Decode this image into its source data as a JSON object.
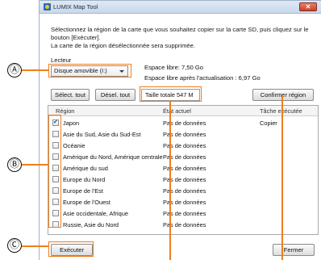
{
  "window": {
    "title": "LUMIX Map Tool",
    "close_label": "✕"
  },
  "description": {
    "line1": "Sélectionnez la région de la carte que vous souhaitez copier sur la carte SD, puis cliquez sur le",
    "line2": "bouton [Exécuter].",
    "line3": "La carte de la région désélectionnée sera supprimée."
  },
  "drive": {
    "label": "Lecteur",
    "selected": "Disque amovible (I:)"
  },
  "space": {
    "free": "Espace libre:  7,50 Go",
    "after": "Espace libre après l'actualisation :  6,97 Go"
  },
  "buttons": {
    "select_all": "Sélect. tout",
    "deselect_all": "Désel. tout",
    "confirm": "Confirmer région",
    "execute": "Exécuter",
    "close": "Fermer"
  },
  "total_size": "Taille totale  547 M",
  "list": {
    "headers": {
      "region": "Région",
      "state": "État actuel",
      "task": "Tâche exécutée"
    },
    "rows": [
      {
        "name": "Japon",
        "state": "Pas de données",
        "task": "Copier",
        "checked": true
      },
      {
        "name": "Asie du Sud, Asie du Sud-Est",
        "state": "Pas de données",
        "task": "",
        "checked": false
      },
      {
        "name": "Océanie",
        "state": "Pas de données",
        "task": "",
        "checked": false
      },
      {
        "name": "Amérique du Nord, Amérique centrale",
        "state": "Pas de données",
        "task": "",
        "checked": false
      },
      {
        "name": "Amérique du sud",
        "state": "Pas de données",
        "task": "",
        "checked": false
      },
      {
        "name": "Europe du Nord",
        "state": "Pas de données",
        "task": "",
        "checked": false
      },
      {
        "name": "Europe de l'Est",
        "state": "Pas de données",
        "task": "",
        "checked": false
      },
      {
        "name": "Europe de l'Ouest",
        "state": "Pas de données",
        "task": "",
        "checked": false
      },
      {
        "name": "Asie occidentale, Afrique",
        "state": "Pas de données",
        "task": "",
        "checked": false
      },
      {
        "name": "Russie, Asie du Nord",
        "state": "Pas de données",
        "task": "",
        "checked": false
      }
    ]
  },
  "callouts": {
    "a": "Ⓐ",
    "b": "Ⓑ",
    "c": "Ⓒ"
  },
  "colors": {
    "highlight": "#ef7e1c"
  }
}
